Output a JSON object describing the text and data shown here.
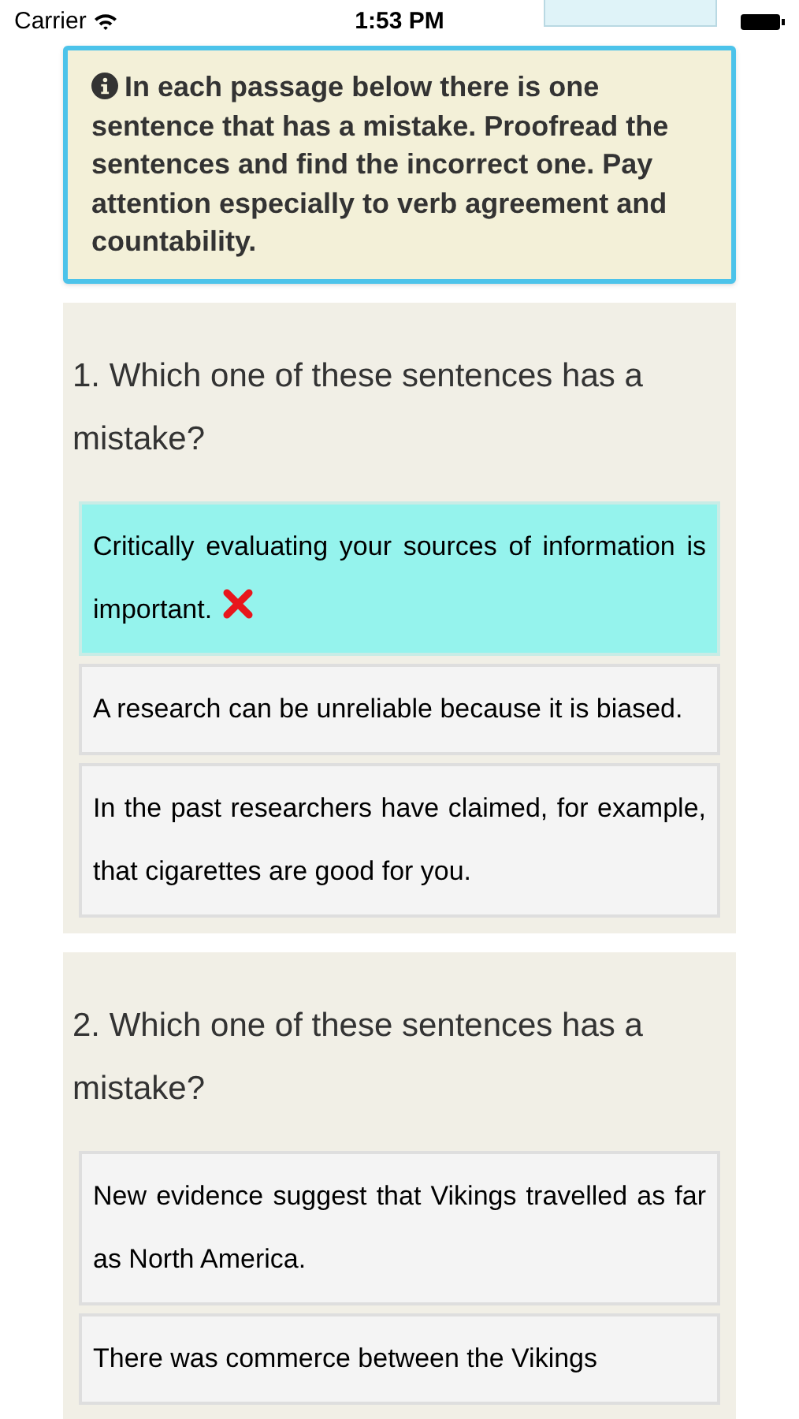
{
  "status_bar": {
    "carrier": "Carrier",
    "time": "1:53 PM"
  },
  "instructions": "In each passage below there is one sentence that has a mistake. Proofread the sentences and find the incorrect one. Pay attention especially to verb agreement and countability.",
  "questions": [
    {
      "prompt": "1. Which one of these sentences has a mistake?",
      "options": [
        {
          "text": "Critically evaluating your sources of information is important.",
          "selected": true,
          "marked_wrong": true
        },
        {
          "text": "A research can be unreliable because it is biased.",
          "selected": false,
          "marked_wrong": false
        },
        {
          "text": "In the past researchers have claimed, for example, that cigarettes are good for you.",
          "selected": false,
          "marked_wrong": false
        }
      ]
    },
    {
      "prompt": "2. Which one of these sentences has a mistake?",
      "options": [
        {
          "text": "New evidence suggest that Vikings travelled as far as North America.",
          "selected": false,
          "marked_wrong": false
        },
        {
          "text": "There was commerce between the Vikings",
          "selected": false,
          "marked_wrong": false
        }
      ]
    }
  ]
}
